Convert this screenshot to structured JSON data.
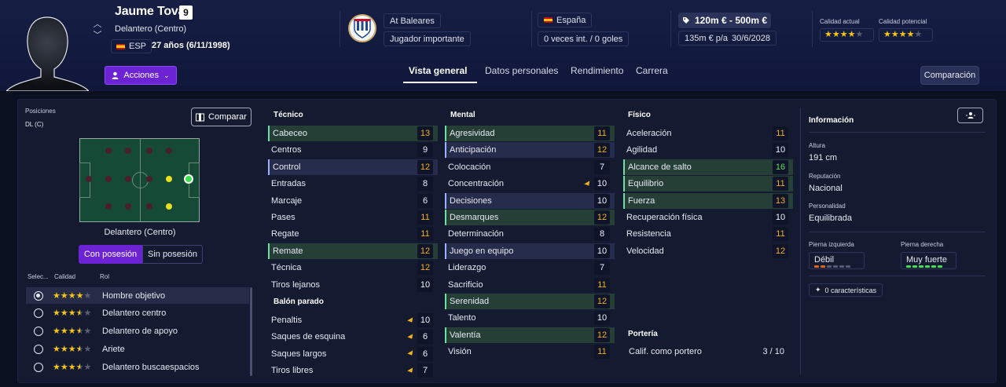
{
  "player": {
    "name": "Jaume Tovar",
    "number": "9",
    "role": "Delantero (Centro)",
    "nationality_code": "ESP",
    "age": "27 años (6/11/1998)",
    "actions_label": "Acciones"
  },
  "club": {
    "name": "At Baleares",
    "status": "Jugador importante"
  },
  "nation": {
    "name": "España",
    "caps": "0 veces int. / 0 goles"
  },
  "value": {
    "range": "120m € - 500m €",
    "wage": "135m € p/a",
    "contract_end": "30/6/2028"
  },
  "quality": {
    "current_label": "Calidad actual",
    "potential_label": "Calidad potencial",
    "current_stars": 4,
    "potential_stars": 4
  },
  "tabs": [
    "Vista general",
    "Datos personales",
    "Rendimiento",
    "Carrera"
  ],
  "comparison_label": "Comparación",
  "positions": {
    "label": "Posiciones",
    "value": "DL (C)",
    "compare_label": "Comparar",
    "caption": "Delantero (Centro)",
    "toggle_on": "Con posesión",
    "toggle_off": "Sin posesión"
  },
  "roles": {
    "headers": [
      "Selec...",
      "Calidad",
      "Rol"
    ],
    "items": [
      {
        "name": "Hombre objetivo",
        "stars": 4,
        "selected": true
      },
      {
        "name": "Delantero centro",
        "stars": 3.5,
        "selected": false
      },
      {
        "name": "Delantero de apoyo",
        "stars": 3.5,
        "selected": false
      },
      {
        "name": "Ariete",
        "stars": 3.5,
        "selected": false
      },
      {
        "name": "Delantero buscaespacios",
        "stars": 3.5,
        "selected": false
      }
    ]
  },
  "tecnico": {
    "title": "Técnico",
    "attrs": [
      {
        "name": "Cabeceo",
        "value": "13",
        "hl": "green",
        "color": "o"
      },
      {
        "name": "Centros",
        "value": "9",
        "hl": "",
        "color": "w"
      },
      {
        "name": "Control",
        "value": "12",
        "hl": "blue",
        "color": "o"
      },
      {
        "name": "Entradas",
        "value": "8",
        "hl": "",
        "color": "w"
      },
      {
        "name": "Marcaje",
        "value": "6",
        "hl": "",
        "color": "w"
      },
      {
        "name": "Pases",
        "value": "11",
        "hl": "",
        "color": "o"
      },
      {
        "name": "Regate",
        "value": "11",
        "hl": "",
        "color": "o"
      },
      {
        "name": "Remate",
        "value": "12",
        "hl": "green",
        "color": "o"
      },
      {
        "name": "Técnica",
        "value": "12",
        "hl": "",
        "color": "o"
      },
      {
        "name": "Tiros lejanos",
        "value": "10",
        "hl": "",
        "color": "w"
      }
    ]
  },
  "balon_parado": {
    "title": "Balón parado",
    "attrs": [
      {
        "name": "Penaltis",
        "value": "10",
        "hl": "",
        "color": "w",
        "flag": true
      },
      {
        "name": "Saques de esquina",
        "value": "6",
        "hl": "",
        "color": "w",
        "flag": true
      },
      {
        "name": "Saques largos",
        "value": "6",
        "hl": "",
        "color": "w",
        "flag": true
      },
      {
        "name": "Tiros libres",
        "value": "7",
        "hl": "",
        "color": "w",
        "flag": true
      }
    ]
  },
  "mental": {
    "title": "Mental",
    "attrs": [
      {
        "name": "Agresividad",
        "value": "11",
        "hl": "green",
        "color": "o"
      },
      {
        "name": "Anticipación",
        "value": "12",
        "hl": "blue",
        "color": "o"
      },
      {
        "name": "Colocación",
        "value": "7",
        "hl": "",
        "color": "w"
      },
      {
        "name": "Concentración",
        "value": "10",
        "hl": "",
        "color": "w",
        "flag": true
      },
      {
        "name": "Decisiones",
        "value": "10",
        "hl": "blue",
        "color": "w"
      },
      {
        "name": "Desmarques",
        "value": "12",
        "hl": "green",
        "color": "o"
      },
      {
        "name": "Determinación",
        "value": "8",
        "hl": "",
        "color": "w"
      },
      {
        "name": "Juego en equipo",
        "value": "10",
        "hl": "blue",
        "color": "w"
      },
      {
        "name": "Liderazgo",
        "value": "7",
        "hl": "",
        "color": "w"
      },
      {
        "name": "Sacrificio",
        "value": "11",
        "hl": "",
        "color": "o"
      },
      {
        "name": "Serenidad",
        "value": "12",
        "hl": "green",
        "color": "o"
      },
      {
        "name": "Talento",
        "value": "10",
        "hl": "",
        "color": "w"
      },
      {
        "name": "Valentía",
        "value": "12",
        "hl": "green",
        "color": "o"
      },
      {
        "name": "Visión",
        "value": "11",
        "hl": "",
        "color": "o"
      }
    ]
  },
  "fisico": {
    "title": "Físico",
    "attrs": [
      {
        "name": "Aceleración",
        "value": "11",
        "hl": "",
        "color": "o"
      },
      {
        "name": "Agilidad",
        "value": "10",
        "hl": "",
        "color": "w"
      },
      {
        "name": "Alcance de salto",
        "value": "16",
        "hl": "green",
        "color": "g"
      },
      {
        "name": "Equilibrio",
        "value": "11",
        "hl": "green",
        "color": "o"
      },
      {
        "name": "Fuerza",
        "value": "13",
        "hl": "green",
        "color": "o"
      },
      {
        "name": "Recuperación física",
        "value": "10",
        "hl": "",
        "color": "w"
      },
      {
        "name": "Resistencia",
        "value": "11",
        "hl": "",
        "color": "o"
      },
      {
        "name": "Velocidad",
        "value": "12",
        "hl": "",
        "color": "o"
      }
    ]
  },
  "porteria": {
    "title": "Portería",
    "label": "Calif. como portero",
    "value": "3 / 10"
  },
  "info": {
    "title": "Información",
    "height_label": "Altura",
    "height": "191 cm",
    "reputation_label": "Reputación",
    "reputation": "Nacional",
    "personality_label": "Personalidad",
    "personality": "Equilibrada",
    "left_foot_label": "Pierna izquierda",
    "left_foot": "Débil",
    "left_foot_level": 0.33,
    "right_foot_label": "Pierna derecha",
    "right_foot": "Muy fuerte",
    "right_foot_level": 1.0,
    "traits": "0 características"
  }
}
